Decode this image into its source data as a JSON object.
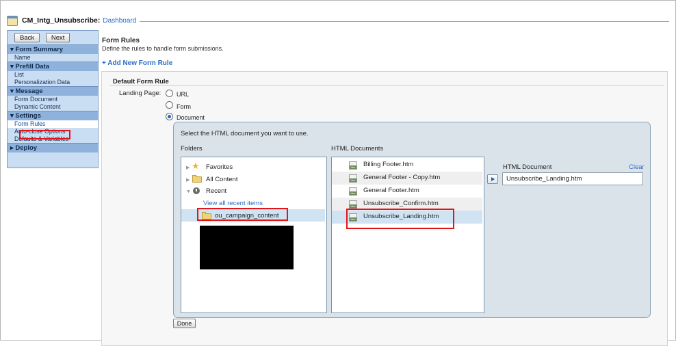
{
  "header": {
    "title": "CM_Intg_Unsubscribe:",
    "breadcrumb_link": "Dashboard"
  },
  "nav": {
    "back_label": "Back",
    "next_label": "Next",
    "sections": [
      {
        "label": "▾ Form Summary",
        "items": [
          "Name"
        ]
      },
      {
        "label": "▾ Prefill Data",
        "items": [
          "List",
          "Personalization Data"
        ]
      },
      {
        "label": "▾ Message",
        "items": [
          "Form Document",
          "Dynamic Content"
        ]
      },
      {
        "label": "▾ Settings",
        "items": [
          "Form Rules",
          "Auto-close Options",
          "Defaults & Variables"
        ]
      },
      {
        "label": "▸ Deploy",
        "items": []
      }
    ],
    "selected_item": "Form Rules"
  },
  "main": {
    "title": "Form Rules",
    "description": "Define the rules to handle form submissions.",
    "add_rule_label": "+ Add New Form Rule",
    "rule_title": "Default Form Rule",
    "landing_page_label": "Landing Page:",
    "options": [
      "URL",
      "Form",
      "Document"
    ],
    "selected_option": "Document"
  },
  "picker": {
    "prompt": "Select the HTML document you want to use.",
    "folders_label": "Folders",
    "docs_label": "HTML Documents",
    "tree": {
      "favorites": "Favorites",
      "all_content": "All Content",
      "recent": "Recent",
      "view_all": "View all recent items",
      "selected_folder": "ou_campaign_content"
    },
    "documents": [
      "Billing Footer.htm",
      "General Footer - Copy.htm",
      "General Footer.htm",
      "Unsubscribe_Confirm.htm",
      "Unsubscribe_Landing.htm"
    ],
    "selected_document": "Unsubscribe_Landing.htm",
    "html_document_label": "HTML Document",
    "clear_label": "Clear",
    "html_document_value": "Unsubscribe_Landing.htm",
    "done_label": "Done"
  },
  "colors": {
    "accent_link": "#2a6cc4",
    "nav_bg": "#c9ddf3",
    "highlight_red": "#e0151a",
    "selection": "#cfe3f3"
  }
}
